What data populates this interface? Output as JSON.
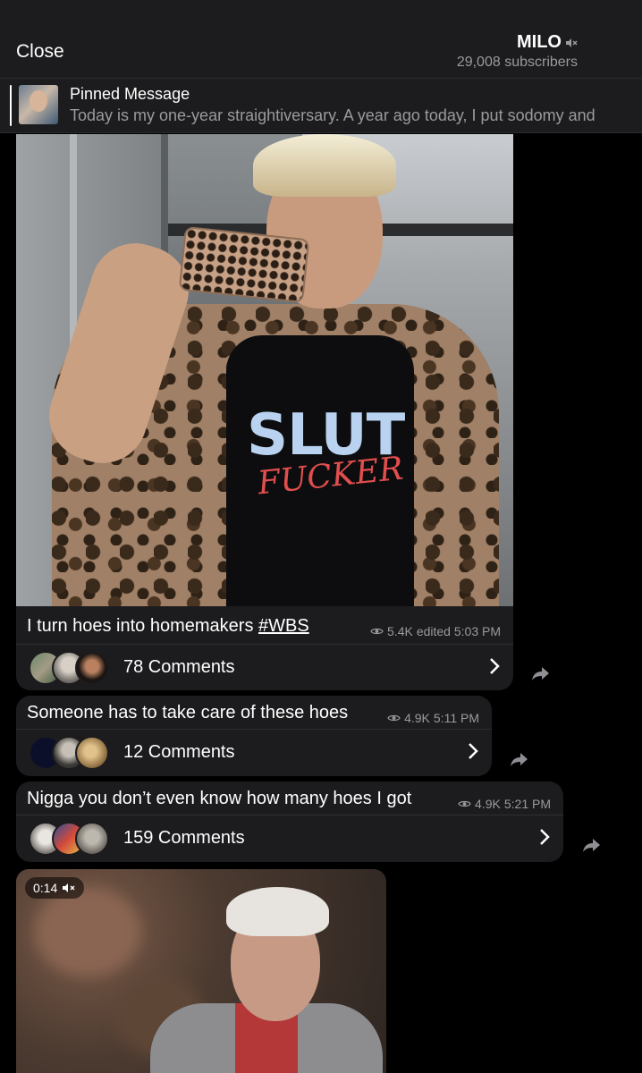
{
  "header": {
    "close_label": "Close",
    "channel_name": "MILO",
    "subscribers": "29,008 subscribers"
  },
  "pinned": {
    "label": "Pinned Message",
    "text": "Today is my one-year straightiversary. A year ago today, I put sodomy and"
  },
  "photo": {
    "shirt_line1": "SLUT",
    "shirt_line2": "FUCKER"
  },
  "posts": [
    {
      "text": "I turn hoes into homemakers ",
      "hashtag": "#WBS",
      "views": "5.4K",
      "time": "edited 5:03 PM",
      "comments": "78 Comments"
    },
    {
      "text": "Someone has to take care of these hoes",
      "views": "4.9K",
      "time": "5:11 PM",
      "comments": "12 Comments"
    },
    {
      "text": "Nigga you don’t even know how many hoes I got",
      "views": "4.9K",
      "time": "5:21 PM",
      "comments": "159 Comments"
    }
  ],
  "video": {
    "duration": "0:14"
  },
  "colors": {
    "background": "#000000",
    "bubble": "#1c1c1e",
    "secondary_text": "#9a9a9f"
  }
}
